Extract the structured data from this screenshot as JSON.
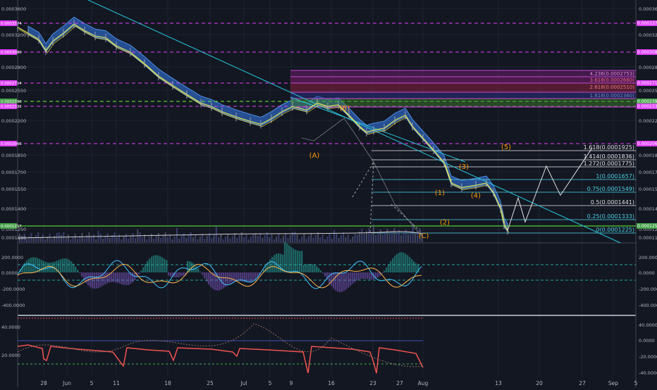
{
  "chart_data": {
    "type": "line",
    "x_ticks": [
      "28",
      "Jun",
      "5",
      "11",
      "18",
      "25",
      "Jul",
      "5",
      "9",
      "16",
      "23",
      "27",
      "Aug",
      "13",
      "20",
      "27",
      "Sep",
      "5"
    ],
    "y_ticks": [
      "0.0003600",
      "0.0003200",
      "0.0002800",
      "0.0002550",
      "0.0002200",
      "0.0001850",
      "0.0001700",
      "0.0001550",
      "0.0001400",
      "0.0001250",
      "0.0001130"
    ],
    "price_tags_left": [
      "0.0003374",
      "0.0003080",
      "0.0002714",
      "0.0002390",
      "0.0002332",
      "0.0002066",
      "0.0001257"
    ],
    "price_tags_right": [
      "0.0003374",
      "0.0003080",
      "0.0002714",
      "0.0002390",
      "0.0002332",
      "0.0002066",
      "0.0001257"
    ],
    "osc_ticks": [
      "200.0000",
      "0.0000",
      "-200.0000",
      "-400.0000"
    ],
    "bottom_ticks": [
      "40.0000",
      "20.0000",
      "0.0000",
      "-20.0000",
      "-40.0000"
    ],
    "fib_ext_labels": [
      "1.618(0.0001925)",
      "1.414(0.0001836)",
      "1.272(0.0001775)",
      "1(0.0001657)",
      "0.75(0.0001549)",
      "0.5(0.0001441)",
      "0.25(0.0001333)",
      "0(0.0001225)"
    ],
    "fib_box_labels": [
      "4.236(0.0002753)",
      "3.618(0.0002660)",
      "2.618(0.0002510)",
      "1.618(0.0002360)"
    ],
    "wave_labels": [
      "(A)",
      "(B)",
      "(C)",
      "(1)",
      "(2)",
      "(3)",
      "(4)",
      "(5)"
    ],
    "price_series": [
      [
        0,
        0.000331
      ],
      [
        3,
        0.000322
      ],
      [
        6,
        0.000314
      ],
      [
        8,
        0.0003
      ],
      [
        10,
        0.000312
      ],
      [
        13,
        0.000322
      ],
      [
        16,
        0.000336
      ],
      [
        19,
        0.000326
      ],
      [
        22,
        0.000318
      ],
      [
        25,
        0.000316
      ],
      [
        28,
        0.000306
      ],
      [
        32,
        0.000298
      ],
      [
        36,
        0.000284
      ],
      [
        40,
        0.00027
      ],
      [
        44,
        0.00026
      ],
      [
        48,
        0.00025
      ],
      [
        52,
        0.00024
      ],
      [
        55,
        0.000236
      ],
      [
        58,
        0.00023
      ],
      [
        62,
        0.000224
      ],
      [
        66,
        0.000219
      ],
      [
        69,
        0.000216
      ],
      [
        72,
        0.000222
      ],
      [
        75,
        0.00023
      ],
      [
        78,
        0.000236
      ],
      [
        82,
        0.000232
      ],
      [
        85,
        0.00024
      ],
      [
        88,
        0.000236
      ],
      [
        91,
        0.000238
      ],
      [
        94,
        0.000226
      ],
      [
        97,
        0.000214
      ],
      [
        99,
        0.000208
      ],
      [
        101,
        0.00021
      ],
      [
        104,
        0.000212
      ],
      [
        107,
        0.00022
      ],
      [
        110,
        0.000226
      ],
      [
        112,
        0.000214
      ],
      [
        115,
        0.000202
      ],
      [
        118,
        0.00019
      ],
      [
        121,
        0.000178
      ],
      [
        123,
        0.00016
      ],
      [
        126,
        0.000156
      ],
      [
        130,
        0.000158
      ],
      [
        133,
        0.00016
      ],
      [
        135,
        0.000152
      ],
      [
        137,
        0.00014
      ],
      [
        138,
        0.000128
      ],
      [
        139,
        0.0001225
      ]
    ],
    "projection": [
      [
        139,
        0.0001225
      ],
      [
        142,
        0.000148
      ],
      [
        144,
        0.00013
      ],
      [
        150,
        0.000175
      ],
      [
        154,
        0.00015
      ],
      [
        163,
        0.000192
      ]
    ]
  }
}
